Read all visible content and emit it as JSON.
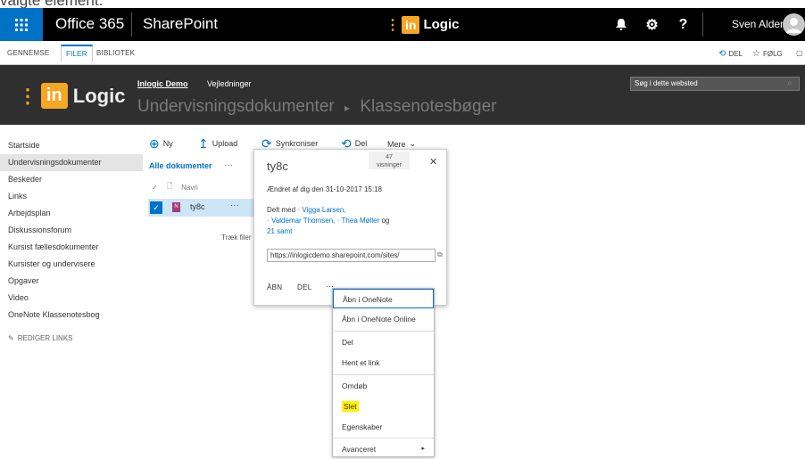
{
  "caption": "valgte element.",
  "suite_bar": {
    "app_launcher_icon": "waffle-icon",
    "office_label": "Office 365",
    "sharepoint_label": "SharePoint",
    "logo": {
      "prefix": "in",
      "name": "Logic"
    },
    "notifications_icon": "bell-icon",
    "settings_icon": "gear-icon",
    "help_label": "?",
    "user_name": "Sven Aldenryd",
    "avatar_icon": "avatar-icon"
  },
  "ribbon": {
    "tabs": [
      "GENNEMSE",
      "FILER",
      "BIBLIOTEK"
    ],
    "share_label": "DEL",
    "follow_label": "FØLG"
  },
  "site_header": {
    "logo": {
      "prefix": "in",
      "name": "Logic"
    },
    "top_nav": [
      "Inlogic Demo",
      "Vejledninger"
    ],
    "breadcrumb": [
      "Undervisningsdokumenter",
      "Klassenotesbøger"
    ],
    "breadcrumb_separator": "▸",
    "search_placeholder": "Søg i dette websted"
  },
  "left_nav": {
    "items": [
      {
        "label": "Startside",
        "selected": false
      },
      {
        "label": "Undervisningsdokumenter",
        "selected": true
      },
      {
        "label": "Beskeder",
        "selected": false
      },
      {
        "label": "Links",
        "selected": false
      },
      {
        "label": "Arbejdsplan",
        "selected": false
      },
      {
        "label": "Diskussionsforum",
        "selected": false
      },
      {
        "label": "Kursist fællesdokumenter",
        "selected": false
      },
      {
        "label": "Kursister og undervisere",
        "selected": false
      },
      {
        "label": "Opgaver",
        "selected": false
      },
      {
        "label": "Video",
        "selected": false
      },
      {
        "label": "OneNote Klassenotesbog",
        "selected": false
      }
    ],
    "edit_links": "REDIGER LINKS"
  },
  "command_bar": {
    "new": "Ny",
    "upload": "Upload",
    "sync": "Synkroniser",
    "share": "Del",
    "more": "Mere"
  },
  "library": {
    "view": "Alle dokumenter",
    "view_more": "···",
    "column_name": "Navn",
    "rows": [
      {
        "name": "ty8c",
        "selected": true
      }
    ],
    "row_ellipsis": "···",
    "drag_hint": "Træk filer"
  },
  "callout": {
    "title": "ty8c",
    "views_count": "47",
    "views_label": "visninger",
    "close": "✕",
    "modified": "Ændret af dig den 31-10-2017 15:18",
    "shared_prefix": "Delt med",
    "shared_people": [
      "Vigga Larsen,",
      "Valdemar Thomsen,",
      "Thea Møller"
    ],
    "shared_and": "og",
    "shared_more": "21 samt",
    "url": "https://inlogicdemo.sharepoint.com/sites/",
    "actions": [
      "ÅBN",
      "DEL"
    ],
    "ellipsis": "···"
  },
  "context_menu": {
    "items": [
      "Åbn i OneNote",
      "Åbn i OneNote Online",
      "Del",
      "Hent et link",
      "Omdøb",
      "Slet",
      "Egenskaber",
      "Avanceret"
    ],
    "highlighted": "Slet",
    "submenu_arrow": "▸"
  },
  "colors": {
    "suite_bar": "#000000",
    "waffle": "#0072c6",
    "accent": "#0072c6",
    "header": "#2f2f2f",
    "brand_orange": "#f5a623",
    "highlight": "#fef200",
    "selected_row": "#cde6f7"
  }
}
